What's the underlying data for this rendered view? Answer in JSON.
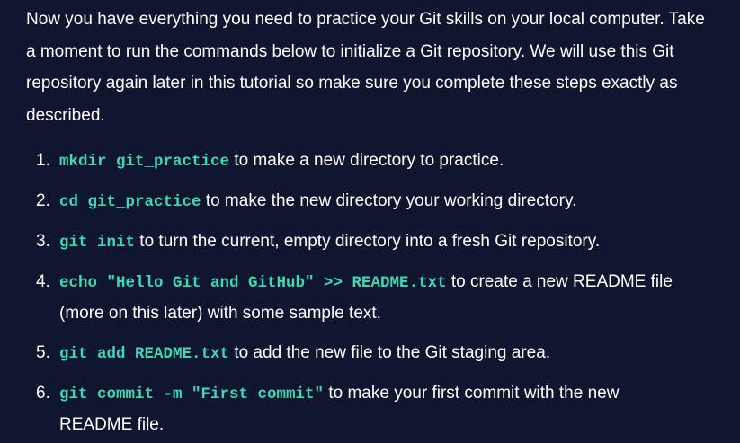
{
  "intro": "Now you have everything you need to practice your Git skills on your local computer. Take a moment to run the commands below to initialize a Git repository. We will use this Git repository again later in this tutorial so make sure you complete these steps exactly as described.",
  "steps": [
    {
      "number": "1.",
      "command": "mkdir git_practice",
      "description": "to make a new directory to practice."
    },
    {
      "number": "2.",
      "command": "cd git_practice",
      "description": "to make the new directory your working directory."
    },
    {
      "number": "3.",
      "command": "git init",
      "description": "to turn the current, empty directory into a fresh Git repository."
    },
    {
      "number": "4.",
      "command": "echo \"Hello Git and GitHub\" >> README.txt",
      "description": "to create a new README file (more on this later) with some sample text."
    },
    {
      "number": "5.",
      "command": "git add README.txt",
      "description": "to add the new file to the Git staging area."
    },
    {
      "number": "6.",
      "command": "git commit -m \"First commit\"",
      "description": "to make your first commit with the new README file."
    }
  ]
}
